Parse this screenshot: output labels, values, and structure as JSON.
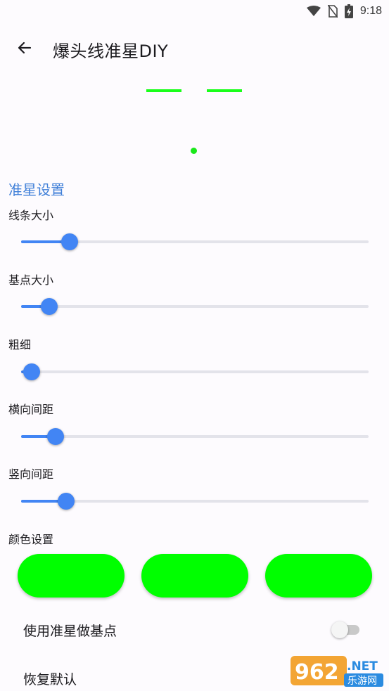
{
  "status_bar": {
    "time": "9:18",
    "icons": [
      "wifi-icon",
      "no-sim-icon",
      "battery-charging-icon"
    ]
  },
  "app_bar": {
    "title": "爆头线准星DIY",
    "back_icon": "arrow-left-icon"
  },
  "preview": {
    "crosshair_color": "#1aff1a",
    "dot_color": "#1ae81a"
  },
  "settings": {
    "section_title": "准星设置",
    "sliders": [
      {
        "label": "线条大小",
        "value": 0.14
      },
      {
        "label": "基点大小",
        "value": 0.08
      },
      {
        "label": "粗细",
        "value": 0.03
      },
      {
        "label": "横向间距",
        "value": 0.1
      },
      {
        "label": "竖向间距",
        "value": 0.13
      }
    ],
    "accent_color": "#4285f4",
    "section_color": "#3f7fd8"
  },
  "colors": {
    "label": "颜色设置",
    "swatches": [
      "#00ff00",
      "#00ff00",
      "#00ff00"
    ]
  },
  "options": {
    "use_crosshair_as_base": {
      "label": "使用准星做基点",
      "enabled": false
    },
    "restore_default": {
      "label": "恢复默认"
    }
  },
  "watermark": {
    "number": "962",
    "suffix": ".NET",
    "subtitle": "乐游网"
  }
}
